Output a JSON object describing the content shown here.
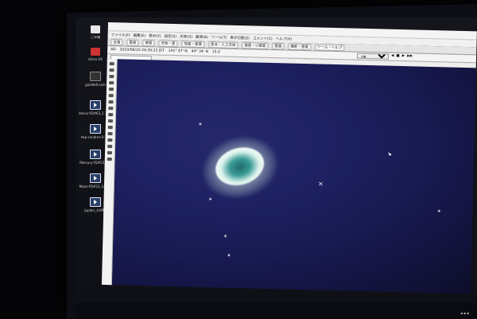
{
  "desktop": {
    "icons": [
      {
        "label": "ごみ箱",
        "type": "recycle"
      },
      {
        "label": "stirco VX",
        "type": "app"
      },
      {
        "label": "guiddell.com",
        "type": "app"
      },
      {
        "label": "Venus-YD#63_1.14…",
        "type": "video"
      },
      {
        "label": "hep-cendres-0-1…",
        "type": "video"
      },
      {
        "label": "Mercury-YD#23_4…",
        "type": "video"
      },
      {
        "label": "Moon-YD#23_4.44…",
        "type": "video"
      },
      {
        "label": "Jupiter_4.MP4",
        "type": "video"
      }
    ]
  },
  "app": {
    "menu": [
      "ファイル(F)",
      "編集(E)",
      "表示(V)",
      "設定(S)",
      "天体(O)",
      "観測(B)",
      "ツール(T)",
      "表示切替(Z)",
      "コメント(C)",
      "ヘルプ(H)"
    ],
    "toolbar": [
      "全画",
      "星座",
      "惑星",
      "天体・星",
      "恒星・星雲",
      "実点・人工天体",
      "彗星・小惑星",
      "星図",
      "撮影・望遠",
      "ツール・ヘルプ"
    ],
    "status": {
      "era": "AD",
      "datetime": "2019/06/10 20:30:22 JST",
      "longitude": "141° 47' N",
      "latitude": "44° 34' N",
      "extra": "15.0",
      "zoom_select": "3倍"
    }
  },
  "sky": {
    "object": "ring-nebula"
  }
}
